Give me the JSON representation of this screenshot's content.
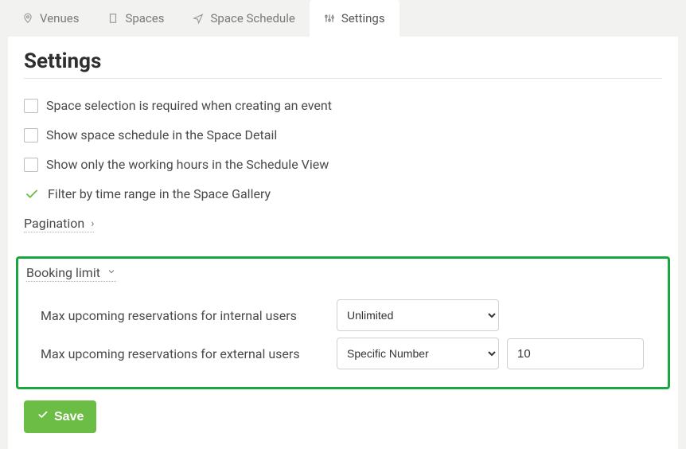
{
  "tabs": {
    "venues": "Venues",
    "spaces": "Spaces",
    "schedule": "Space Schedule",
    "settings": "Settings"
  },
  "page": {
    "title": "Settings"
  },
  "options": {
    "spaceSelectionRequired": "Space selection is required when creating an event",
    "showSpaceSchedule": "Show space schedule in the Space Detail",
    "showWorkingHours": "Show only the working hours in the Schedule View",
    "filterByTimeRange": "Filter by time range in the Space Gallery"
  },
  "sections": {
    "pagination": "Pagination",
    "bookingLimit": "Booking limit"
  },
  "bookingLimit": {
    "internalLabel": "Max upcoming reservations for internal users",
    "internalValue": "Unlimited",
    "externalLabel": "Max upcoming reservations for external users",
    "externalValue": "Specific Number",
    "externalNumber": "10"
  },
  "buttons": {
    "save": "Save"
  }
}
